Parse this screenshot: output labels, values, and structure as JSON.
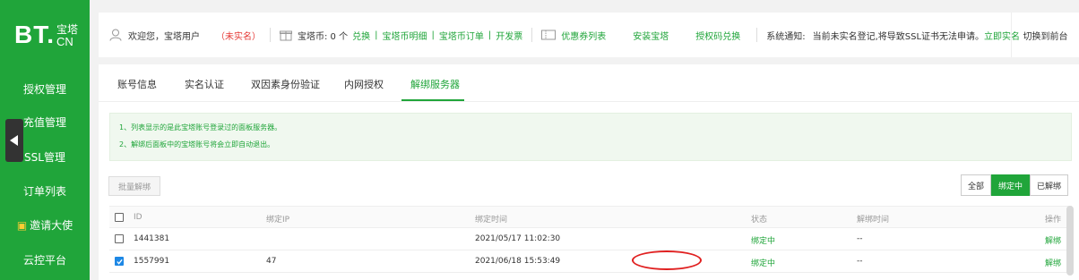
{
  "sidebar": {
    "logo_main": "BT.",
    "logo_top": "宝塔",
    "logo_bottom": "CN",
    "items": [
      {
        "label": "授权管理"
      },
      {
        "label": "充值管理"
      },
      {
        "label": "SSL管理"
      },
      {
        "label": "订单列表"
      },
      {
        "label": "邀请大使"
      },
      {
        "label": "云控平台"
      }
    ]
  },
  "topbar": {
    "welcome": "欢迎您，宝塔用户",
    "unverified": "（未实名）",
    "coins": "宝塔币: 0 个",
    "redeem": "兑换",
    "coin_detail": "宝塔币明细",
    "coin_orders": "宝塔币订单",
    "invoice": "开发票",
    "coupons": "优惠券列表",
    "install": "安装宝塔",
    "auth_code": "授权码兑换",
    "notice_label": "系统通知:",
    "notice_text": "当前未实名登记,将导致SSL证书无法申请。",
    "notice_link": "立即实名",
    "switch": "切换到前台"
  },
  "tabs": [
    {
      "label": "账号信息"
    },
    {
      "label": "实名认证"
    },
    {
      "label": "双因素身份验证"
    },
    {
      "label": "内网授权"
    },
    {
      "label": "解绑服务器"
    }
  ],
  "notice": {
    "line1": "1、列表显示的是此宝塔账号登录过的面板服务器。",
    "line2": "2、解绑后面板中的宝塔账号将会立即自动退出。"
  },
  "batch_unbind": "批量解绑",
  "filter": {
    "all": "全部",
    "bound": "绑定中",
    "unbound": "已解绑"
  },
  "table": {
    "headers": {
      "id": "ID",
      "ip": "绑定IP",
      "time": "绑定时间",
      "status": "状态",
      "unbind_time": "解绑时间",
      "action": "操作"
    },
    "rows": [
      {
        "id": "1441381",
        "ip": "",
        "time": "2021/05/17 11:02:30",
        "status": "绑定中",
        "unbind_time": "--",
        "action": "解绑"
      },
      {
        "id": "1557991",
        "ip": "47",
        "time": "2021/06/18 15:53:49",
        "status": "绑定中",
        "unbind_time": "--",
        "action": "解绑"
      }
    ]
  },
  "colors": {
    "brand": "#20a53a",
    "highlight": "#e02020"
  }
}
